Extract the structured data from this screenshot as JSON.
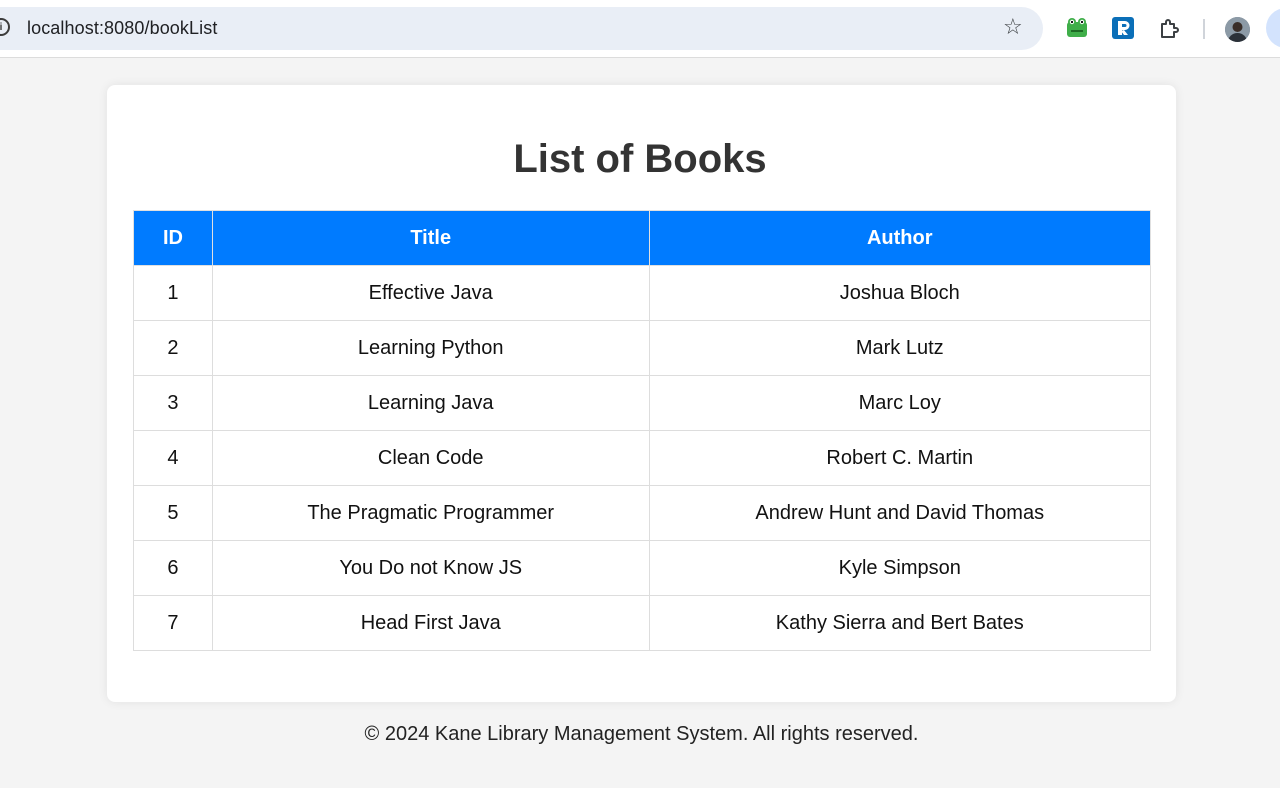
{
  "browser": {
    "url": "localhost:8080/bookList",
    "site_info_glyph": "i",
    "icons": [
      "info-icon",
      "star-icon",
      "frog-extension-icon",
      "r-extension-icon",
      "puzzle-icon",
      "avatar"
    ]
  },
  "page": {
    "title": "List of Books",
    "table": {
      "headers": [
        "ID",
        "Title",
        "Author"
      ],
      "rows": [
        {
          "id": "1",
          "title": "Effective Java",
          "author": "Joshua Bloch"
        },
        {
          "id": "2",
          "title": "Learning Python",
          "author": "Mark Lutz"
        },
        {
          "id": "3",
          "title": "Learning Java",
          "author": "Marc Loy"
        },
        {
          "id": "4",
          "title": "Clean Code",
          "author": "Robert C. Martin"
        },
        {
          "id": "5",
          "title": "The Pragmatic Programmer",
          "author": "Andrew Hunt and David Thomas"
        },
        {
          "id": "6",
          "title": "You Do not Know JS",
          "author": "Kyle Simpson"
        },
        {
          "id": "7",
          "title": "Head First Java",
          "author": "Kathy Sierra and Bert Bates"
        }
      ]
    },
    "footer": "© 2024 Kane Library Management System. All rights reserved."
  },
  "colors": {
    "header_bg": "#007bff",
    "page_bg": "#f4f4f4",
    "card_bg": "#ffffff"
  }
}
